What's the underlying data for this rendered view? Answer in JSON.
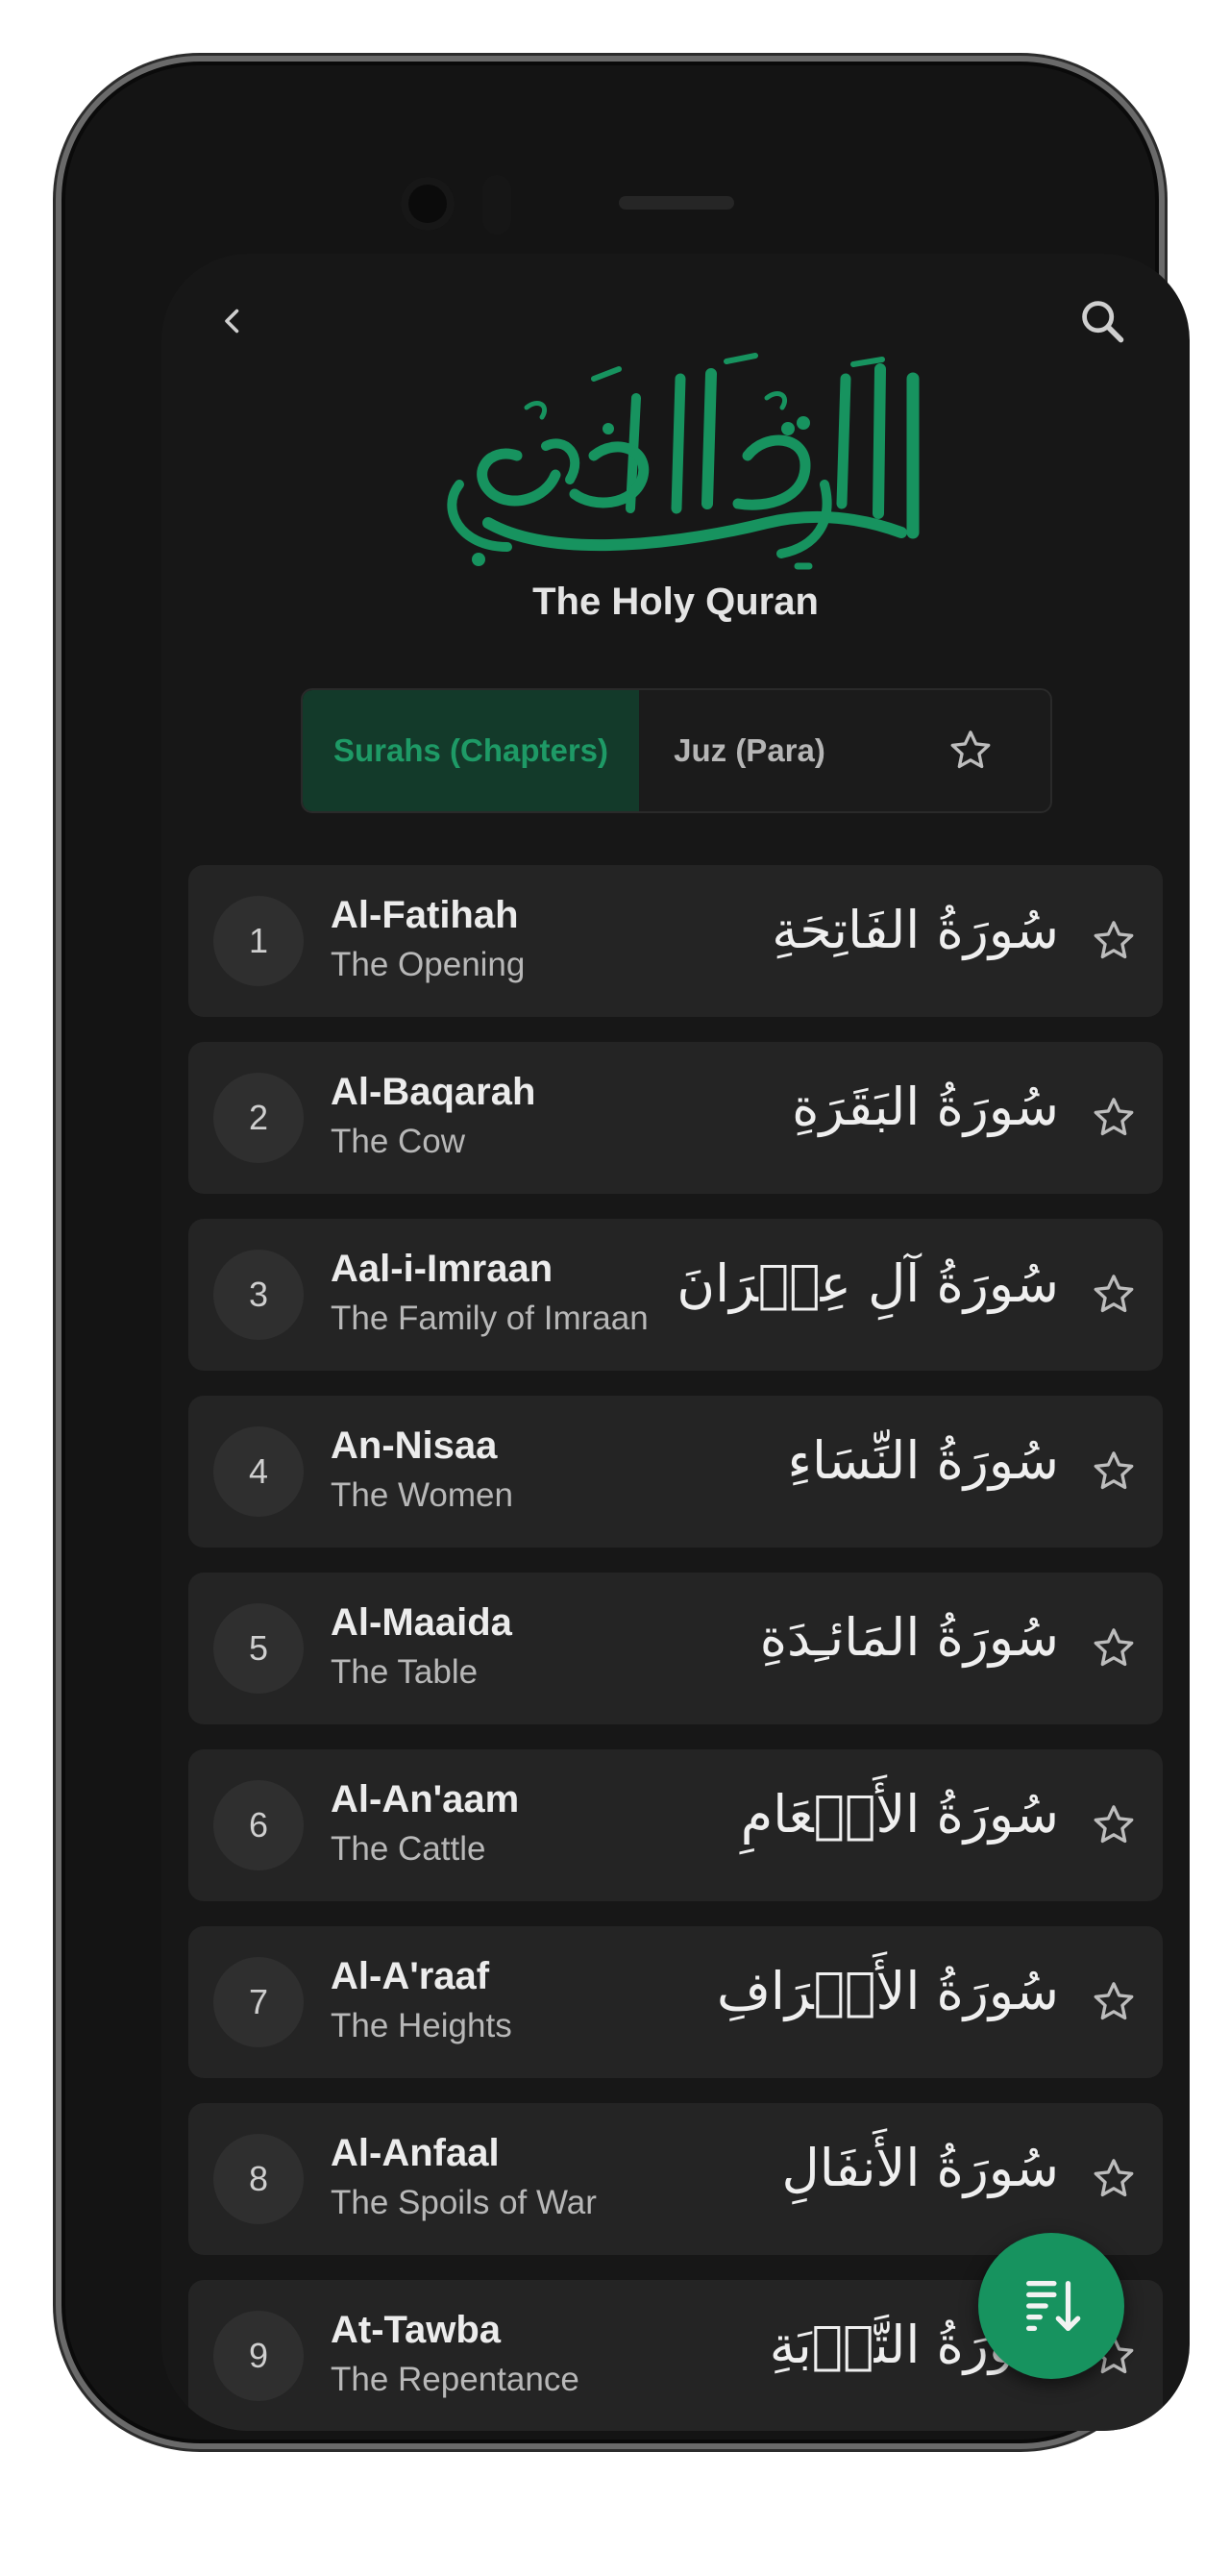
{
  "header": {
    "calligraphy": "القرآن الكريم",
    "title": "The Holy Quran"
  },
  "tabs": {
    "surahs_label": "Surahs (Chapters)",
    "juz_label": "Juz (Para)",
    "active": "Surahs (Chapters)"
  },
  "surahs": [
    {
      "number": "1",
      "name": "Al-Fatihah",
      "translation": "The Opening",
      "arabic": "سُورَةُ الفَاتِحَةِ"
    },
    {
      "number": "2",
      "name": "Al-Baqarah",
      "translation": "The Cow",
      "arabic": "سُورَةُ البَقَرَةِ"
    },
    {
      "number": "3",
      "name": "Aal-i-Imraan",
      "translation": "The Family of Imraan",
      "arabic": "سُورَةُ آلِ عِمۡرَانَ"
    },
    {
      "number": "4",
      "name": "An-Nisaa",
      "translation": "The Women",
      "arabic": "سُورَةُ النِّسَاءِ"
    },
    {
      "number": "5",
      "name": "Al-Maaida",
      "translation": "The Table",
      "arabic": "سُورَةُ المَائـِدَةِ"
    },
    {
      "number": "6",
      "name": "Al-An'aam",
      "translation": "The Cattle",
      "arabic": "سُورَةُ الأَنۡعَامِ"
    },
    {
      "number": "7",
      "name": "Al-A'raaf",
      "translation": "The Heights",
      "arabic": "سُورَةُ الأَعۡرَافِ"
    },
    {
      "number": "8",
      "name": "Al-Anfaal",
      "translation": "The Spoils of War",
      "arabic": "سُورَةُ الأَنفَالِ"
    },
    {
      "number": "9",
      "name": "At-Tawba",
      "translation": "The Repentance",
      "arabic": "سُورَةُ التَّوۡبَةِ"
    }
  ],
  "icons": {
    "back": "chevron-left-icon",
    "search": "search-icon",
    "favorite": "star-outline-icon",
    "sort": "sort-descending-icon"
  },
  "colors": {
    "accent": "#17935f",
    "accent_text": "#1e9a66",
    "background": "#171717",
    "card": "#242424"
  }
}
